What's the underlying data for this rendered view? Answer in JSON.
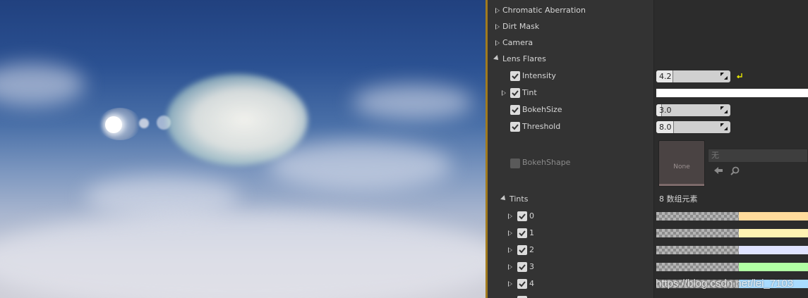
{
  "categories": [
    {
      "label": "Chromatic Aberration",
      "expanded": false
    },
    {
      "label": "Dirt Mask",
      "expanded": false
    },
    {
      "label": "Camera",
      "expanded": false
    },
    {
      "label": "Lens Flares",
      "expanded": true
    }
  ],
  "lens_flares": {
    "intensity": {
      "label": "Intensity",
      "value": "4.2",
      "fill": 0.23
    },
    "tint": {
      "label": "Tint",
      "color": "#ffffff"
    },
    "bokeh_size": {
      "label": "BokehSize",
      "value": "3.0",
      "fill": 0.08
    },
    "threshold": {
      "label": "Threshold",
      "value": "8.0",
      "fill": 0.24
    },
    "bokeh_shape": {
      "label": "BokehShape",
      "thumb_text": "None",
      "asset_value": "无"
    },
    "tints": {
      "label": "Tints",
      "count_text": "8 数组元素",
      "items": [
        {
          "index": "0",
          "color": "#ffdb9c"
        },
        {
          "index": "1",
          "color": "#fff3b3"
        },
        {
          "index": "2",
          "color": "#e0e3ff"
        },
        {
          "index": "3",
          "color": "#b1ffa3"
        },
        {
          "index": "4",
          "color": "#a9dcff"
        }
      ]
    }
  },
  "watermark": "https://blog.csdn.net/lei_7103",
  "colors": {
    "accent_border": "#a07a1e",
    "reset_arrow": "#e6e600"
  }
}
